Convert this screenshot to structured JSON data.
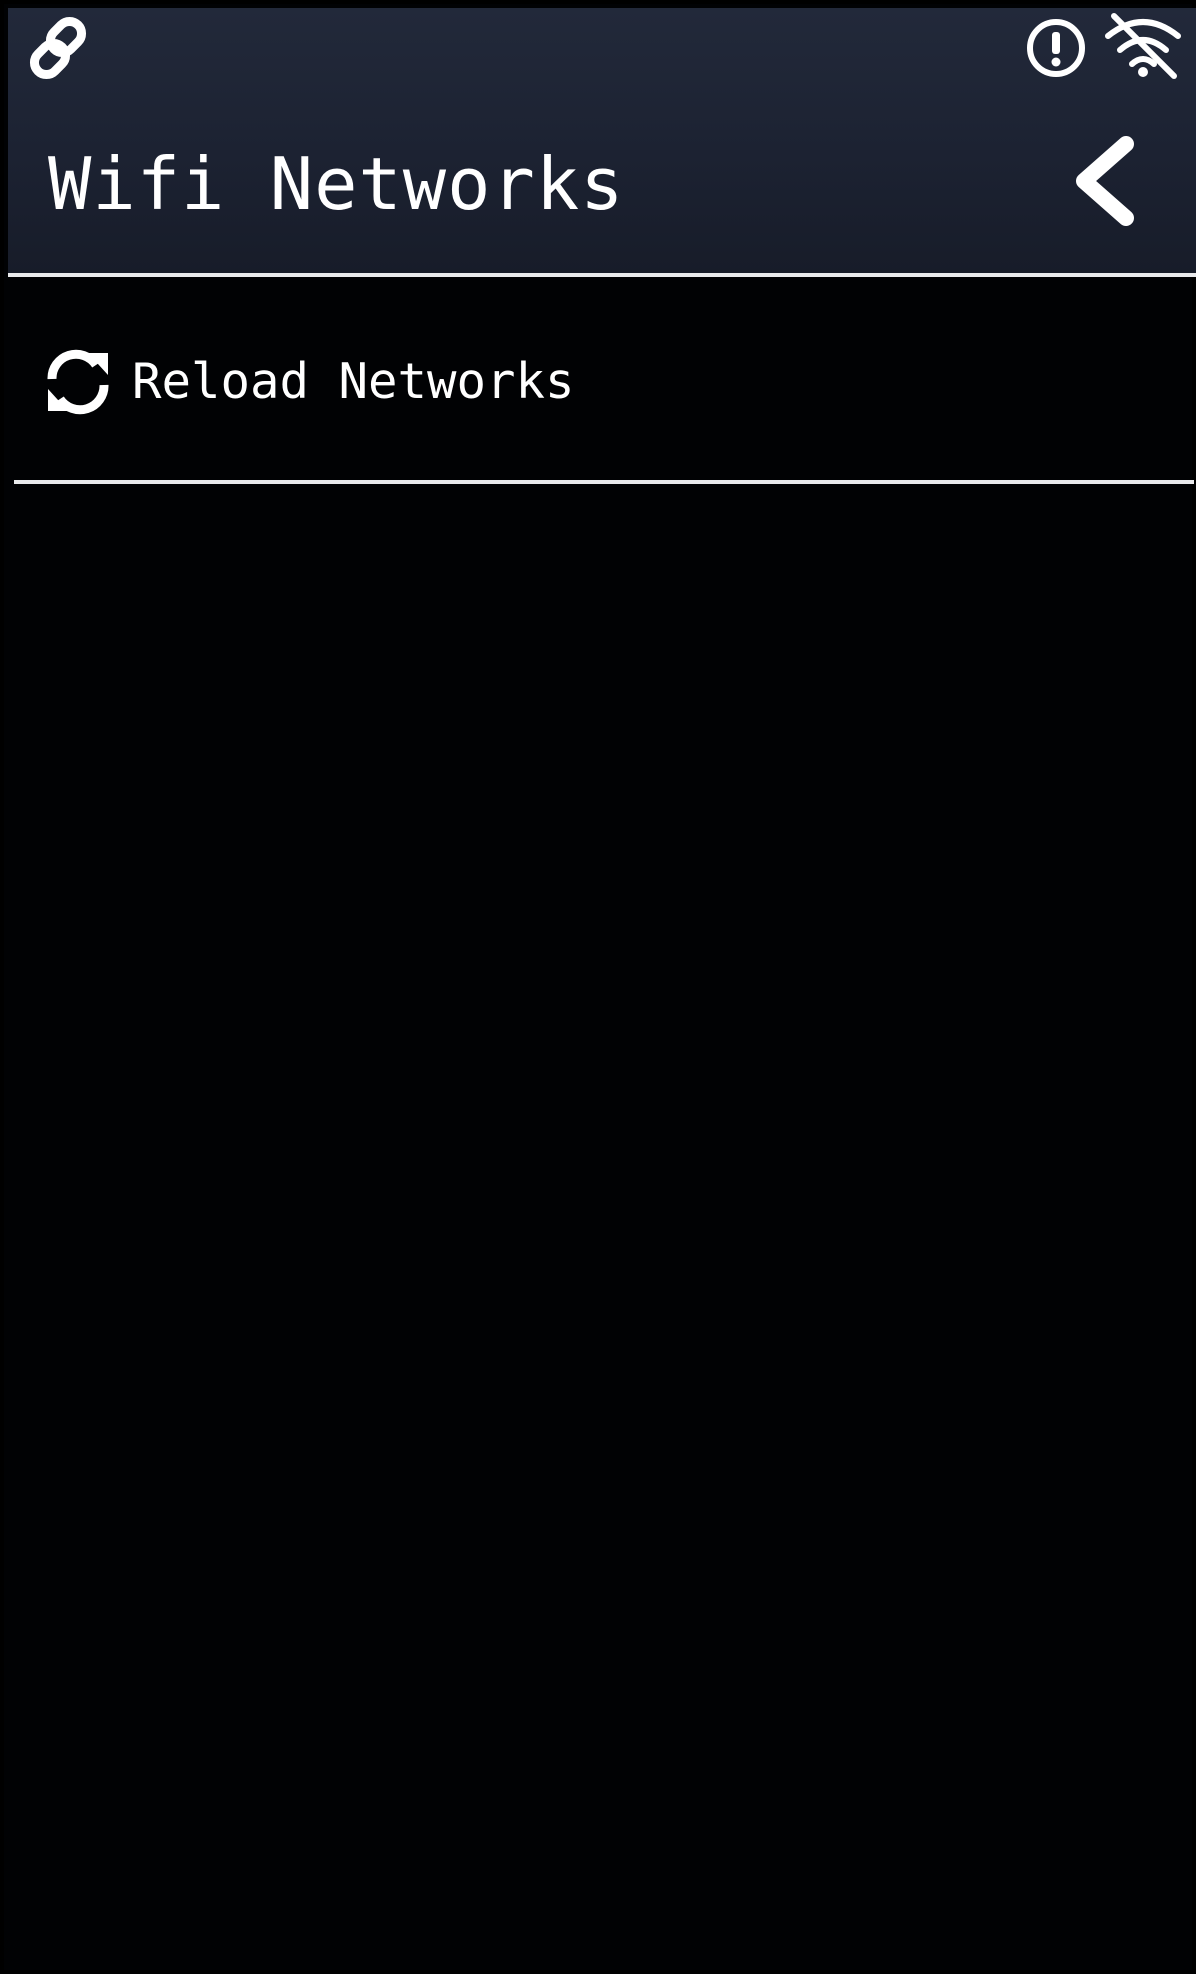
{
  "status_bar": {
    "icons": [
      "link-icon",
      "alert-circle-icon",
      "wifi-off-icon"
    ]
  },
  "header": {
    "title": "Wifi Networks",
    "back_icon": "chevron-left-icon"
  },
  "list": {
    "items": [
      {
        "label": "Reload Networks",
        "icon": "reload-icon"
      }
    ]
  },
  "colors": {
    "header_background": "#1c2232",
    "screen_background": "#010204",
    "text": "#ffffff",
    "divider": "#e9eaec"
  }
}
